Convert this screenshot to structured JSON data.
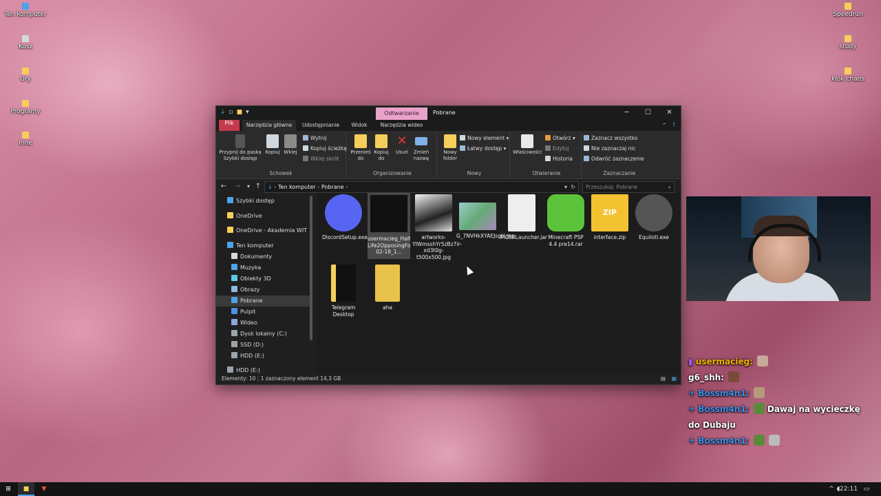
{
  "desktop": {
    "left_icons": [
      {
        "label": "Ten komputer",
        "kind": "pc"
      },
      {
        "label": "Kosz",
        "kind": "bin"
      },
      {
        "label": "Gry",
        "kind": "folder"
      },
      {
        "label": "Programy",
        "kind": "folder"
      },
      {
        "label": "Inne",
        "kind": "folder"
      }
    ],
    "right_icons": [
      {
        "label": "Speedrun",
        "kind": "folder"
      },
      {
        "label": "study",
        "kind": "folder"
      },
      {
        "label": "klok chaos",
        "kind": "folder"
      }
    ]
  },
  "explorer": {
    "context_tab": "Odtwarzanie",
    "title": "Pobrane",
    "controls": {
      "minimize": "─",
      "maximize": "☐",
      "close": "✕"
    },
    "ribbon_tabs": [
      "Plik",
      "Narzędzia główne",
      "Udostępnianie",
      "Widok",
      "Narzędzia wideo"
    ],
    "groups": {
      "schowek": {
        "label": "Schowek",
        "pin": "Przypnij do paska Szybki dostęp",
        "copy": "Kopiuj",
        "paste": "Wklej",
        "cut": "Wytnij",
        "copy_path": "Kopiuj ścieżkę",
        "paste_shortcut": "Wklej skrót"
      },
      "organizowanie": {
        "label": "Organizowanie",
        "move": "Przenieś do",
        "copy_to": "Kopiuj do",
        "delete": "Usuń",
        "rename": "Zmień nazwę"
      },
      "nowy": {
        "label": "Nowy",
        "new_folder": "Nowy folder",
        "new_item": "Nowy element",
        "easy_access": "Łatwy dostęp"
      },
      "otwieranie": {
        "label": "Otwieranie",
        "properties": "Właściwości",
        "open": "Otwórz",
        "edit": "Edytuj",
        "history": "Historia"
      },
      "zaznaczanie": {
        "label": "Zaznaczanie",
        "select_all": "Zaznacz wszystko",
        "select_none": "Nie zaznaczaj nic",
        "invert": "Odwróć zaznaczenie"
      }
    },
    "address": {
      "crumbs": [
        "Ten komputer",
        "Pobrane"
      ],
      "search_placeholder": "Przeszukaj: Pobrane"
    },
    "nav": [
      {
        "label": "Szybki dostęp",
        "color": "#4da3e8",
        "indent": 0
      },
      {
        "label": "OneDrive",
        "color": "#f5cf5a",
        "indent": 0
      },
      {
        "label": "OneDrive - Akademia WIT",
        "color": "#f5cf5a",
        "indent": 0
      },
      {
        "label": "Ten komputer",
        "color": "#4da3e8",
        "indent": 0
      },
      {
        "label": "Dokumenty",
        "color": "#d9d9d9",
        "indent": 1
      },
      {
        "label": "Muzyka",
        "color": "#4da3e8",
        "indent": 1
      },
      {
        "label": "Obiekty 3D",
        "color": "#5cc8e8",
        "indent": 1
      },
      {
        "label": "Obrazy",
        "color": "#8fb8e0",
        "indent": 1
      },
      {
        "label": "Pobrane",
        "color": "#4da3e8",
        "indent": 1
      },
      {
        "label": "Pulpit",
        "color": "#4d8fe8",
        "indent": 1
      },
      {
        "label": "Wideo",
        "color": "#8aa8d8",
        "indent": 1
      },
      {
        "label": "Dysk lokalny (C:)",
        "color": "#9aa4ad",
        "indent": 1
      },
      {
        "label": "SSD (D:)",
        "color": "#9aa4ad",
        "indent": 1
      },
      {
        "label": "HDD (E:)",
        "color": "#9aa4ad",
        "indent": 1
      },
      {
        "label": "HDD (E:)",
        "color": "#9aa4ad",
        "indent": 0
      }
    ],
    "files": [
      {
        "name": "DiscordSetup.exe",
        "thumb": "#5865f2",
        "selected": false
      },
      {
        "name": "usermacieg_Half-Life2OpposingForce_2026-02-18_1...",
        "thumb": "#2a2a2a",
        "selected": true
      },
      {
        "name": "artworks-YIWmsshYr5zBz7ir-xd3t0g-t500x500.jpg",
        "thumb": "#e6e6e6",
        "selected": false
      },
      {
        "name": "G_7NVHkXYAEJsgH.jpg",
        "thumb": "#7aa0a6",
        "selected": false
      },
      {
        "name": "MCSRLauncher.jar",
        "thumb": "#f0f0f0",
        "selected": false
      },
      {
        "name": "Minecraft PSP 4.4 pre14.rar",
        "thumb": "#5cc23a",
        "selected": false
      },
      {
        "name": "interface.zip",
        "thumb": "#f2c230",
        "selected": false
      },
      {
        "name": "Equilotl.exe",
        "thumb": "#6a6a6a",
        "selected": false
      },
      {
        "name": "Telegram Desktop",
        "thumb": "#f5cf5a",
        "selected": false
      },
      {
        "name": "aha",
        "thumb": "#e8c24a",
        "selected": false
      }
    ],
    "status": {
      "count": "Elementy: 10",
      "selected": "1 zaznaczony element  14,3 GB"
    }
  },
  "chat": [
    {
      "user": "usermacieg:",
      "color": "#f0b400",
      "text": ""
    },
    {
      "user": "g6_shh:",
      "color": "#ffffff",
      "text": ""
    },
    {
      "user": "Bossm4n1:",
      "color": "#3b8ee8",
      "text": ""
    },
    {
      "user": "Bossm4n1:",
      "color": "#3b8ee8",
      "text": "Dawaj na wycieczkę do Dubaju"
    },
    {
      "user": "Bossm4n1:",
      "color": "#3b8ee8",
      "text": ""
    }
  ],
  "taskbar": {
    "time": "22:11"
  }
}
